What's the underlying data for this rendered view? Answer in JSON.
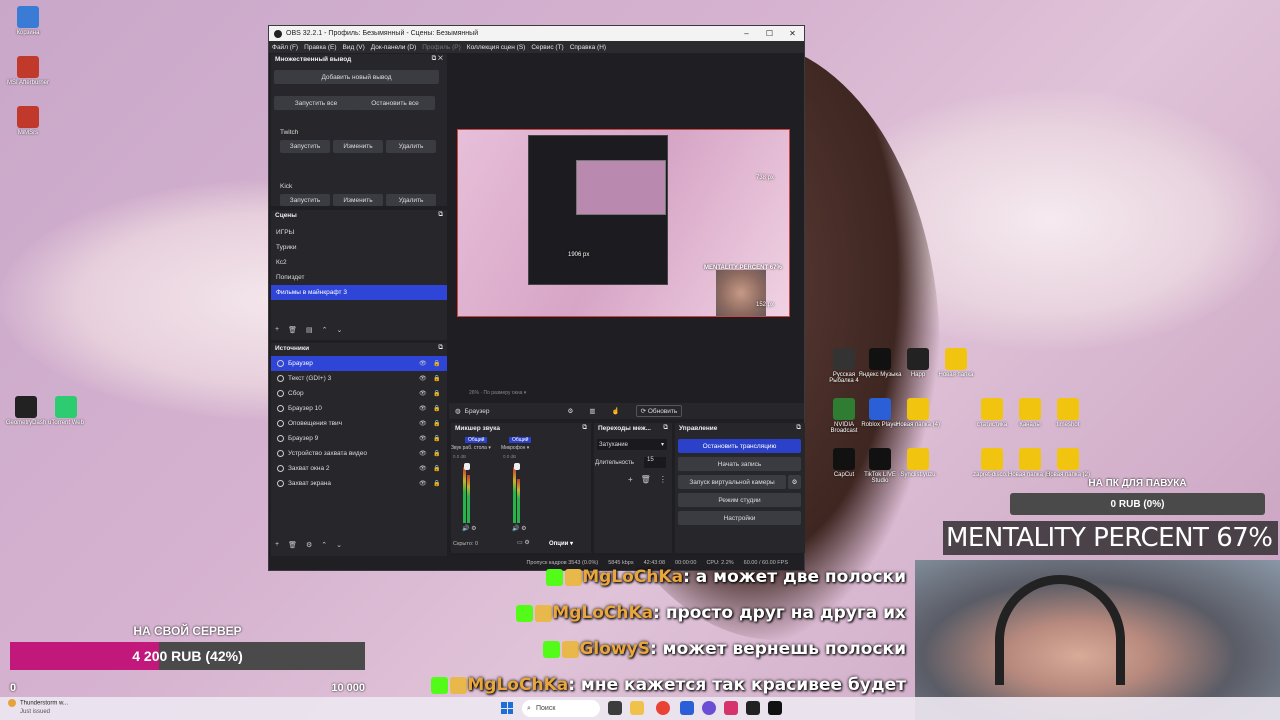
{
  "desktop": {
    "icons_left": [
      {
        "label": "Корзина",
        "color": "#3a7bd5"
      },
      {
        "label": "MSI Afterburner",
        "color": "#c0392b"
      },
      {
        "label": "MiMSrs",
        "color": "#c0392b"
      },
      {
        "label": "GeometryDash",
        "color": "#222222"
      },
      {
        "label": "uTorrent Web",
        "color": "#2ecc71"
      }
    ],
    "icons_right": [
      {
        "label": "Русская Рыбалка 4",
        "color": "#333333"
      },
      {
        "label": "Яндекс Музыка",
        "color": "#111111"
      },
      {
        "label": "Happ",
        "color": "#222222"
      },
      {
        "label": "Новая папка",
        "color": "#f1c40f"
      },
      {
        "label": "NVIDIA Broadcast",
        "color": "#2e7d32"
      },
      {
        "label": "Roblox Player",
        "color": "#2b5fd8"
      },
      {
        "label": "Новая папка (4)",
        "color": "#f1c40f"
      },
      {
        "label": "статистика",
        "color": "#f1c40f"
      },
      {
        "label": "Каналы",
        "color": "#f1c40f"
      },
      {
        "label": "timeshot",
        "color": "#f1c40f"
      },
      {
        "label": "CapCut",
        "color": "#111111"
      },
      {
        "label": "TikTok LIVE Studio",
        "color": "#111111"
      },
      {
        "label": "Synclist.yuzu",
        "color": "#f1c40f"
      },
      {
        "label": "zapret-disco...",
        "color": "#f1c40f"
      },
      {
        "label": "Новая папка (3)",
        "color": "#f1c40f"
      },
      {
        "label": "Новая папка (2)",
        "color": "#f1c40f"
      }
    ]
  },
  "obs": {
    "title": "OBS 32.2.1 - Профиль: Безымянный - Сцены: Безымянный",
    "window_controls": [
      "–",
      "☐",
      "✕"
    ],
    "menu": [
      {
        "label": "Файл (F)",
        "dim": false
      },
      {
        "label": "Правка (E)",
        "dim": false
      },
      {
        "label": "Вид (V)",
        "dim": false
      },
      {
        "label": "Док-панели (D)",
        "dim": false
      },
      {
        "label": "Профиль (P)",
        "dim": true
      },
      {
        "label": "Коллекция сцен (S)",
        "dim": false
      },
      {
        "label": "Сервис (T)",
        "dim": false
      },
      {
        "label": "Справка (H)",
        "dim": false
      }
    ],
    "multi_output": {
      "title": "Множественный вывод",
      "add_button": "Добавить новый вывод",
      "start_all": "Запустить все",
      "stop_all": "Остановить все",
      "outputs": [
        {
          "name": "Twitch",
          "start": "Запустить",
          "edit": "Изменить",
          "delete": "Удалить"
        },
        {
          "name": "Kick",
          "start": "Запустить",
          "edit": "Изменить",
          "delete": "Удалить"
        }
      ]
    },
    "scenes": {
      "title": "Сцены",
      "items": [
        "ИГРЫ",
        "Турики",
        "Кс2",
        "Попиздет",
        "Фильмы в майнкрафт 3"
      ],
      "selected_index": 4
    },
    "sources": {
      "title": "Источники",
      "items": [
        "Браузер",
        "Текст (GDI+) 3",
        "Сбор",
        "Браузер 10",
        "Оповещения твич",
        "Браузер 9",
        "Устройство захвата видео",
        "Захват окна 2",
        "Захват экрана"
      ],
      "selected_index": 0
    },
    "preview": {
      "labels": [
        "738 px",
        "1906 px",
        "MENTALITY PERCENT 67%",
        "152 px"
      ],
      "zoom": "26%",
      "zoom_mode": "По размеру окна"
    },
    "source_toolbar": {
      "source_name": "Браузер",
      "refresh": "Обновить"
    },
    "mixer": {
      "title": "Микшер звука",
      "channels": [
        {
          "tag": "Общий",
          "name": "Звук раб. стола",
          "db": "0.0 dB"
        },
        {
          "tag": "Общий",
          "name": "Микрофон",
          "db": "0.0 dB"
        }
      ],
      "hidden": "Скрыто: 0",
      "options": "Опции"
    },
    "transitions": {
      "title": "Переходы меж...",
      "type": "Затухание",
      "duration_label": "Длительность",
      "duration_value": "15"
    },
    "controls": {
      "title": "Управление",
      "stop_stream": "Остановить трансляцию",
      "start_record": "Начать запись",
      "virtual_cam": "Запуск виртуальной камеры",
      "studio_mode": "Режим студии",
      "settings": "Настройки"
    },
    "status": {
      "dropped": "Пропуск кадров 3543 (0.0%)",
      "bitrate": "5845 kbps",
      "stream_time": "42:43:08",
      "rec_time": "00:00:00",
      "cpu": "CPU: 2.2%",
      "fps": "60.00 / 60.00 FPS"
    }
  },
  "overlays": {
    "donation_top": {
      "label": "НА ПК ДЛЯ ПАВУКА",
      "value": "0 RUB (0%)"
    },
    "mentality": "MENTALITY PERCENT 67%",
    "chat": [
      {
        "nick": "MgLoChKa",
        "message": ": а может две полоски"
      },
      {
        "nick": "MgLoChKa",
        "message": ": просто друг на друга их"
      },
      {
        "nick": "GlowyS",
        "message": ": может вернешь полоски"
      },
      {
        "nick": "MgLoChKa",
        "message": ": мне кажется так красивее будет"
      }
    ],
    "donation_bottom": {
      "label": "НА СВОЙ СЕРВЕР",
      "value": "4 200 RUB (42%)",
      "progress": 0.42,
      "min": "0",
      "max": "10 000"
    }
  },
  "taskbar": {
    "weather_title": "Thunderstorm w...",
    "weather_sub": "Just issued",
    "search_placeholder": "Поиск"
  }
}
